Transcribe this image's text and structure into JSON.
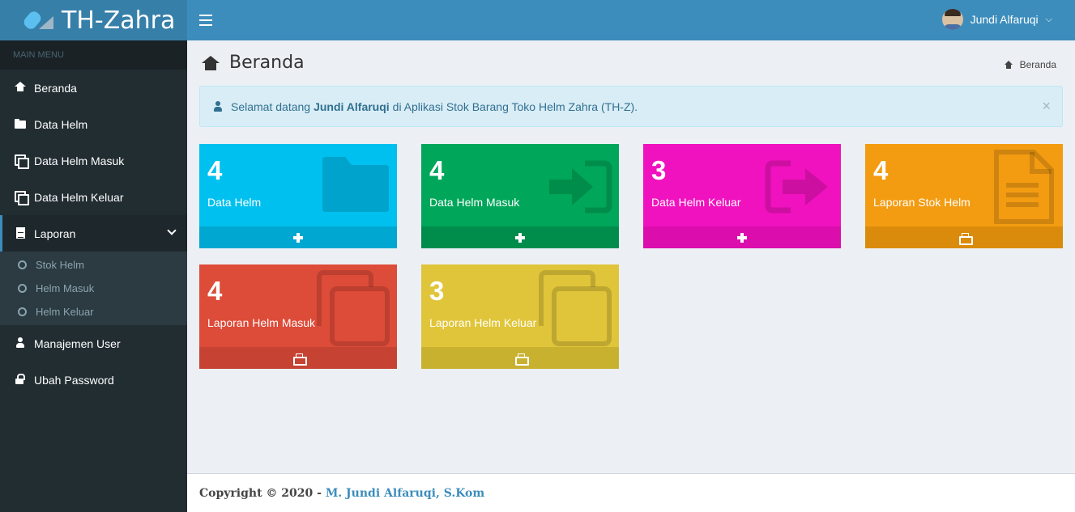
{
  "app": {
    "title": "TH-Zahra"
  },
  "navbar": {
    "user_name": "Jundi Alfaruqi"
  },
  "sidebar": {
    "header": "MAIN MENU",
    "items": [
      {
        "label": "Beranda",
        "icon": "home-icon"
      },
      {
        "label": "Data Helm",
        "icon": "folder-icon"
      },
      {
        "label": "Data Helm Masuk",
        "icon": "copy-icon"
      },
      {
        "label": "Data Helm Keluar",
        "icon": "copy-icon"
      },
      {
        "label": "Laporan",
        "icon": "file-icon",
        "expanded": true
      },
      {
        "label": "Manajemen User",
        "icon": "user-icon"
      },
      {
        "label": "Ubah Password",
        "icon": "lock-icon"
      }
    ],
    "sub_items": [
      {
        "label": "Stok Helm"
      },
      {
        "label": "Helm Masuk"
      },
      {
        "label": "Helm Keluar"
      }
    ]
  },
  "page": {
    "title": "Beranda",
    "breadcrumb": "Beranda"
  },
  "alert": {
    "prefix": "Selamat datang",
    "user": "Jundi Alfaruqi",
    "suffix": "di Aplikasi Stok Barang Toko Helm Zahra (TH-Z).",
    "close": "×"
  },
  "boxes": [
    {
      "count": "4",
      "label": "Data Helm",
      "color": "#00c0ef",
      "footer_color": "#00a7d0",
      "action": "plus-icon",
      "bg_icon": "folder-icon"
    },
    {
      "count": "4",
      "label": "Data Helm Masuk",
      "color": "#00a65a",
      "footer_color": "#008d4c",
      "action": "plus-icon",
      "bg_icon": "sign-in-icon"
    },
    {
      "count": "3",
      "label": "Data Helm Keluar",
      "color": "#f012be",
      "footer_color": "#db0ead",
      "action": "plus-icon",
      "bg_icon": "sign-out-icon"
    },
    {
      "count": "4",
      "label": "Laporan Stok Helm",
      "color": "#f39c12",
      "footer_color": "#db8b0b",
      "action": "print-icon",
      "bg_icon": "file-text-icon"
    },
    {
      "count": "4",
      "label": "Laporan Helm Masuk",
      "color": "#dd4b39",
      "footer_color": "#c64333",
      "action": "print-icon",
      "bg_icon": "copy-icon"
    },
    {
      "count": "3",
      "label": "Laporan Helm Keluar",
      "color": "#e0c53a",
      "footer_color": "#c9b130",
      "action": "print-icon",
      "bg_icon": "copy-icon"
    }
  ],
  "footer": {
    "copyright": "Copyright © 2020 -",
    "author": "M. Jundi Alfaruqi, S.Kom"
  }
}
